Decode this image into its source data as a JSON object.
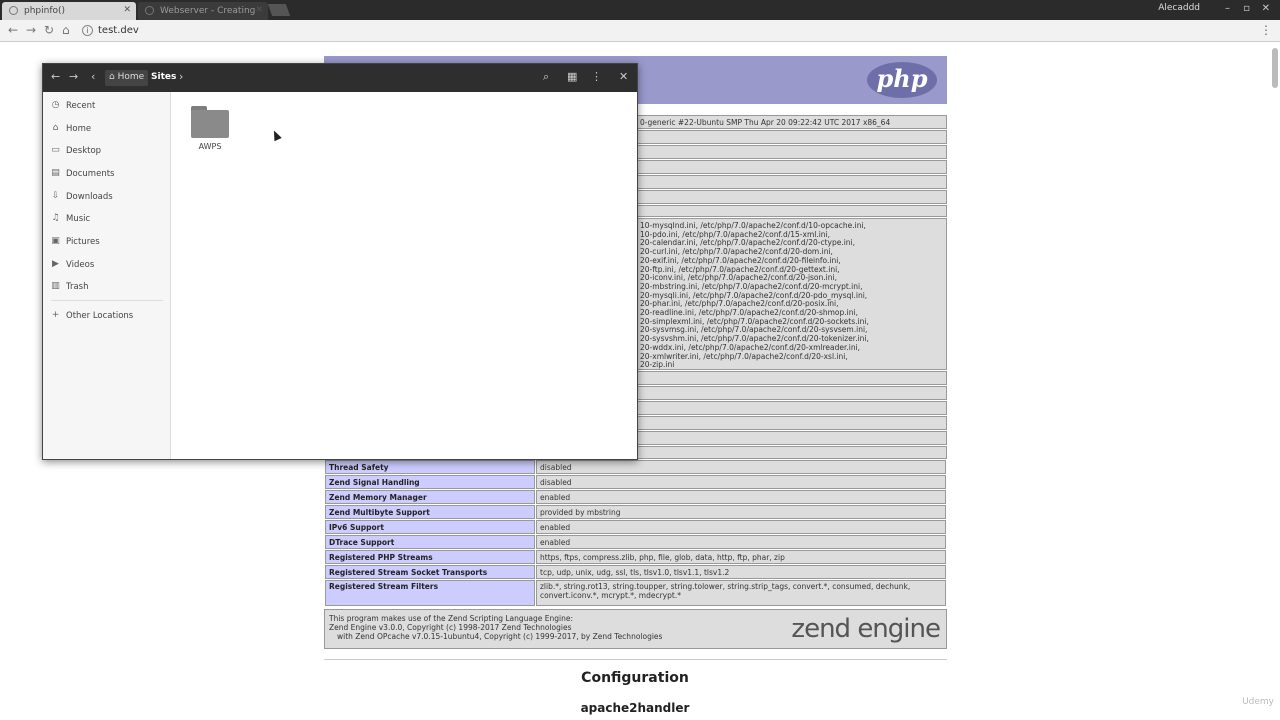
{
  "browser": {
    "tabs": [
      {
        "label": "phpinfo()",
        "active": true
      },
      {
        "label": "Webserver - Creating",
        "active": false
      }
    ],
    "user": "Alecaddd",
    "url": "test.dev"
  },
  "php": {
    "logo_text": "php",
    "system_line": "0-generic #22-Ubuntu SMP Thu Apr 20 09:22:42 UTC 2017 x86_64",
    "ini_lines": [
      "10-mysqlnd.ini, /etc/php/7.0/apache2/conf.d/10-opcache.ini,",
      "10-pdo.ini, /etc/php/7.0/apache2/conf.d/15-xml.ini,",
      "20-calendar.ini, /etc/php/7.0/apache2/conf.d/20-ctype.ini,",
      "20-curl.ini, /etc/php/7.0/apache2/conf.d/20-dom.ini,",
      "20-exif.ini, /etc/php/7.0/apache2/conf.d/20-fileinfo.ini,",
      "20-ftp.ini, /etc/php/7.0/apache2/conf.d/20-gettext.ini,",
      "20-iconv.ini, /etc/php/7.0/apache2/conf.d/20-json.ini,",
      "20-mbstring.ini, /etc/php/7.0/apache2/conf.d/20-mcrypt.ini,",
      "20-mysqli.ini, /etc/php/7.0/apache2/conf.d/20-pdo_mysql.ini,",
      "20-phar.ini, /etc/php/7.0/apache2/conf.d/20-posix.ini,",
      "20-readline.ini, /etc/php/7.0/apache2/conf.d/20-shmop.ini,",
      "20-simplexml.ini, /etc/php/7.0/apache2/conf.d/20-sockets.ini,",
      "20-sysvmsg.ini, /etc/php/7.0/apache2/conf.d/20-sysvsem.ini,",
      "20-sysvshm.ini, /etc/php/7.0/apache2/conf.d/20-tokenizer.ini,",
      "20-wddx.ini, /etc/php/7.0/apache2/conf.d/20-xmlreader.ini,",
      "20-xmlwriter.ini, /etc/php/7.0/apache2/conf.d/20-xsl.ini,",
      "20-zip.ini"
    ],
    "rows": [
      {
        "key": "Thread Safety",
        "value": "disabled"
      },
      {
        "key": "Zend Signal Handling",
        "value": "disabled"
      },
      {
        "key": "Zend Memory Manager",
        "value": "enabled"
      },
      {
        "key": "Zend Multibyte Support",
        "value": "provided by mbstring"
      },
      {
        "key": "IPv6 Support",
        "value": "enabled"
      },
      {
        "key": "DTrace Support",
        "value": "enabled"
      },
      {
        "key": "Registered PHP Streams",
        "value": "https, ftps, compress.zlib, php, file, glob, data, http, ftp, phar, zip"
      },
      {
        "key": "Registered Stream Socket Transports",
        "value": "tcp, udp, unix, udg, ssl, tls, tlsv1.0, tlsv1.1, tlsv1.2"
      },
      {
        "key": "Registered Stream Filters",
        "value": "zlib.*, string.rot13, string.toupper, string.tolower, string.strip_tags, convert.*, consumed, dechunk, convert.iconv.*, mcrypt.*, mdecrypt.*"
      }
    ],
    "zend_text_1": "This program makes use of the Zend Scripting Language Engine:",
    "zend_text_2": "Zend Engine v3.0.0, Copyright (c) 1998-2017 Zend Technologies",
    "zend_text_3": "with Zend OPcache v7.0.15-1ubuntu4, Copyright (c) 1999-2017, by Zend Technologies",
    "zend_logo": "zend engine",
    "heading_config": "Configuration",
    "heading_handler": "apache2handler"
  },
  "file_manager": {
    "breadcrumb": [
      "Home",
      "Sites"
    ],
    "sidebar": [
      {
        "label": "Recent",
        "icon": "clock-icon"
      },
      {
        "label": "Home",
        "icon": "home-icon"
      },
      {
        "label": "Desktop",
        "icon": "desktop-icon"
      },
      {
        "label": "Documents",
        "icon": "document-icon"
      },
      {
        "label": "Downloads",
        "icon": "download-icon"
      },
      {
        "label": "Music",
        "icon": "music-icon"
      },
      {
        "label": "Pictures",
        "icon": "pictures-icon"
      },
      {
        "label": "Videos",
        "icon": "videos-icon"
      },
      {
        "label": "Trash",
        "icon": "trash-icon"
      }
    ],
    "other_locations": "Other Locations",
    "folder_name": "AWPS"
  },
  "overlay": {
    "watermark": "Udemy"
  }
}
